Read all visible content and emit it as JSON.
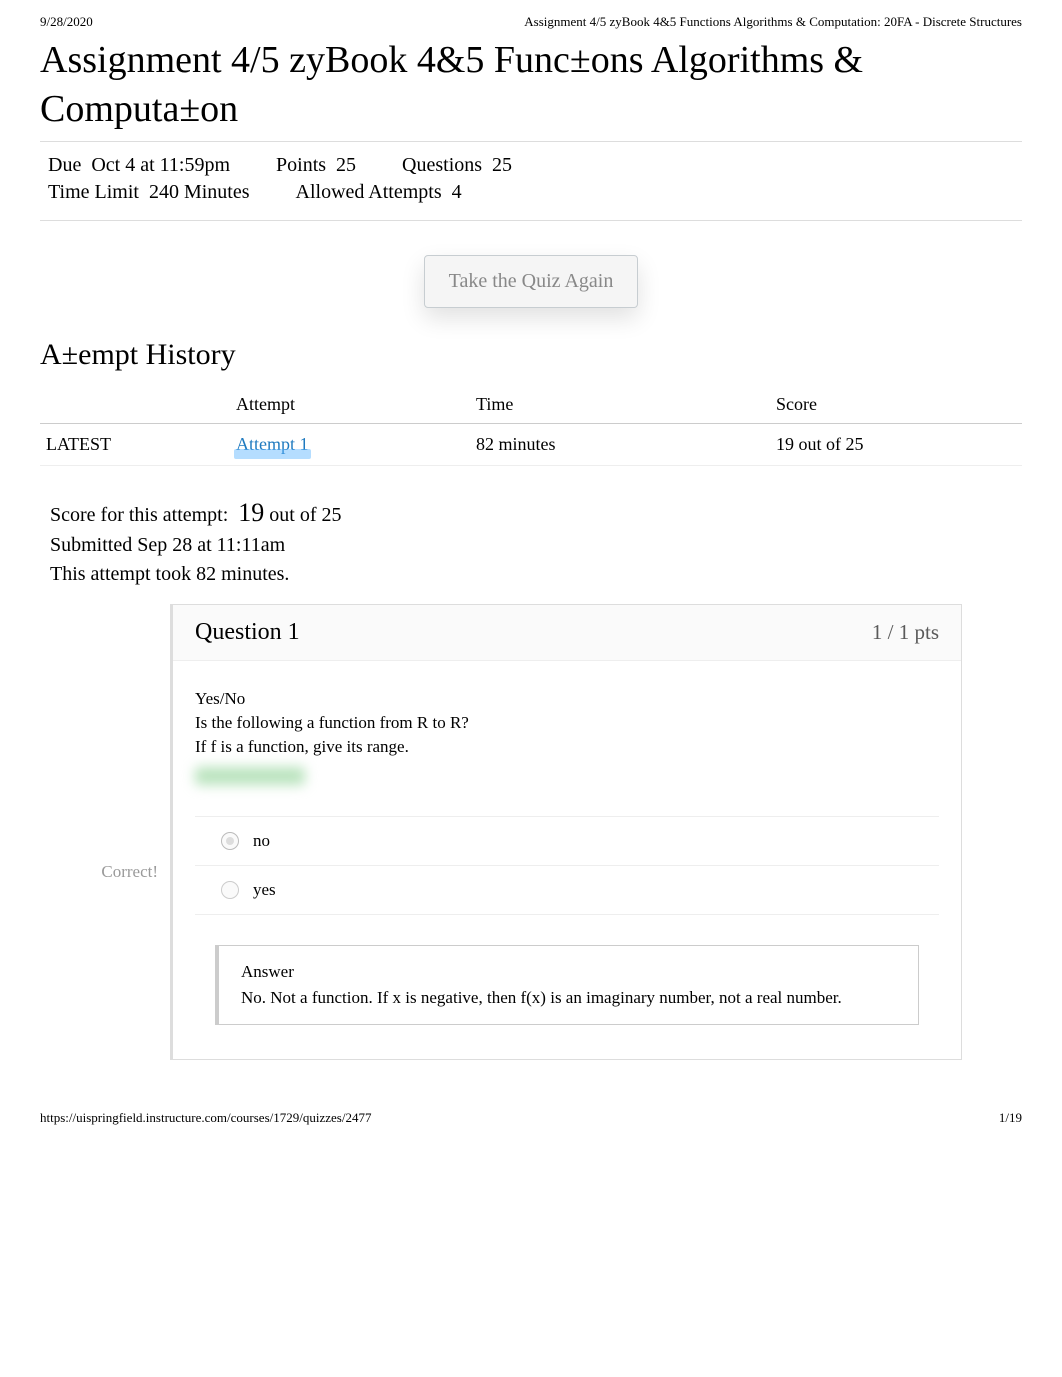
{
  "header": {
    "date": "9/28/2020",
    "doc_title": "Assignment 4/5 zyBook 4&5 Functions Algorithms & Computation: 20FA - Discrete Structures"
  },
  "assignment": {
    "title": "Assignment 4/5 zyBook 4&5 Func±ons Algorithms & Computa±on",
    "meta": {
      "due_label": "Due",
      "due_value": "Oct 4 at 11:59pm",
      "points_label": "Points",
      "points_value": "25",
      "questions_label": "Questions",
      "questions_value": "25",
      "timelimit_label": "Time Limit",
      "timelimit_value": "240 Minutes",
      "allowed_label": "Allowed Attempts",
      "allowed_value": "4"
    }
  },
  "take_again_label": "Take the Quiz Again",
  "history": {
    "title": "A±empt History",
    "cols": {
      "c0": "",
      "c1": "Attempt",
      "c2": "Time",
      "c3": "Score"
    },
    "rows": [
      {
        "tag": "LATEST",
        "attempt_label": "Attempt 1",
        "time": "82 minutes",
        "score": "19 out of 25"
      }
    ]
  },
  "summary": {
    "line1_prefix": "Score for this attempt:",
    "line1_num": "19",
    "line1_suffix": "out of 25",
    "line2": "Submitted Sep 28 at 11:11am",
    "line3": "This attempt took 82 minutes."
  },
  "question1": {
    "title": "Question 1",
    "pts": "1 / 1 pts",
    "body": {
      "p1": "Yes/No",
      "p2": "Is the following a function from R to R?",
      "p3": "If f is a function, give its range."
    },
    "side_correct": "Correct!",
    "options": [
      {
        "text": "no",
        "selected": true
      },
      {
        "text": "yes",
        "selected": false
      }
    ],
    "answer": {
      "label": "Answer",
      "text": "No. Not a function. If x is negative, then f(x) is an imaginary number, not a real number."
    }
  },
  "footer": {
    "url": "https://uispringfield.instructure.com/courses/1729/quizzes/2477",
    "page": "1/19"
  }
}
